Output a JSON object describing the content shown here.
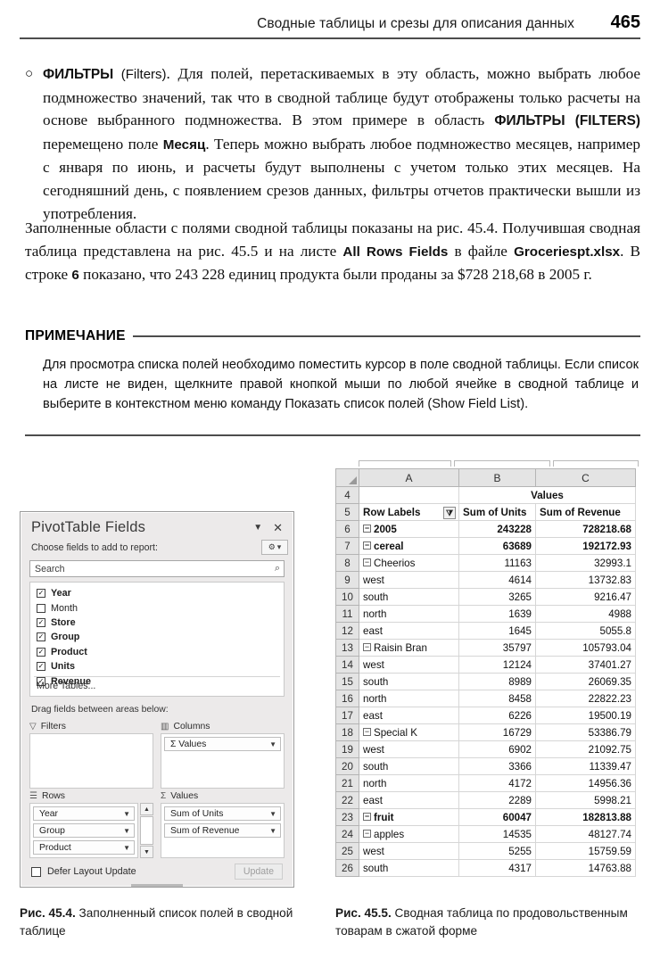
{
  "header": {
    "running_title": "Сводные таблицы и срезы для описания данных",
    "page_number": "465"
  },
  "bullet": {
    "marker": "○",
    "lead_bold": "ФИЛЬТРЫ",
    "lead_paren": "(Filters)",
    "text_1": ". Для полей, перетаскиваемых в эту область, можно выбрать любое подмножество значений, так что в сводной таблице будут отображены только расчеты на основе выбранного подмножества. В этом примере в область ",
    "area_bold": "ФИЛЬТРЫ (FILTERS)",
    "text_2": " перемещено поле ",
    "field_bold": "Месяц",
    "text_3": ". Теперь можно выбрать любое подмножество месяцев, например с января по июнь, и расчеты будут выполнены с учетом только этих месяцев. На сегодняшний день, с появлением срезов данных, фильтры отчетов практически вышли из употребления."
  },
  "paragraph": {
    "t1": "Заполненные области с полями сводной таблицы показаны на рис. 45.4. Получившая сводная таблица представлена на рис. 45.5 и на листе ",
    "sheet_bold": "All Rows Fields",
    "t2": " в файле ",
    "file_bold": "Groceriespt.xlsx",
    "t3": ". В строке ",
    "row_bold": "6",
    "t4": " показано, что 243 228 единиц продукта были проданы за $728 218,68 в 2005 г."
  },
  "note": {
    "title": "ПРИМЕЧАНИЕ",
    "body": "Для просмотра списка полей необходимо поместить курсор в поле сводной таблицы. Если список на листе не виден, щелкните правой кнопкой мыши по любой ячейке в сводной таблице и выберите в контекстном меню команду Показать список полей (Show Field List)."
  },
  "pivot_pane": {
    "title": "PivotTable Fields",
    "collapse_label": "▼",
    "close_label": "✕",
    "subtitle": "Choose fields to add to report:",
    "gear_label": "⚙",
    "gear_caret": "▾",
    "search_placeholder": "Search",
    "search_icon": "⌕",
    "fields": [
      {
        "label": "Year",
        "checked": true
      },
      {
        "label": "Month",
        "checked": false
      },
      {
        "label": "Store",
        "checked": true
      },
      {
        "label": "Group",
        "checked": true
      },
      {
        "label": "Product",
        "checked": true
      },
      {
        "label": "Units",
        "checked": true
      },
      {
        "label": "Revenue",
        "checked": true
      }
    ],
    "more_tables": "More Tables...",
    "drag_text": "Drag fields between areas below:",
    "areas": {
      "filters_label": "Filters",
      "filters_icon": "▽",
      "filters_items": [],
      "columns_label": "Columns",
      "columns_icon": "▥",
      "columns_items": [
        "Σ Values"
      ],
      "rows_label": "Rows",
      "rows_icon": "☰",
      "rows_items": [
        "Year",
        "Group",
        "Product"
      ],
      "values_label": "Values",
      "values_icon": "Σ",
      "values_items": [
        "Sum of Units",
        "Sum of Revenue"
      ]
    },
    "defer_label": "Defer Layout Update",
    "defer_checked": false,
    "update_button": "Update"
  },
  "sheet": {
    "columns": [
      "A",
      "B",
      "C"
    ],
    "merged_values_header": "Values",
    "header_row_number": "4",
    "labels_row_number": "5",
    "row_labels_header": "Row Labels",
    "filter_icon": "⧩",
    "col_b_header": "Sum of Units",
    "col_c_header": "Sum of Revenue",
    "rows": [
      {
        "n": "6",
        "label": "2005",
        "indent": 0,
        "expander": "−",
        "units": "243228",
        "revenue": "728218.68",
        "bold": true
      },
      {
        "n": "7",
        "label": "cereal",
        "indent": 1,
        "expander": "−",
        "units": "63689",
        "revenue": "192172.93",
        "bold": true
      },
      {
        "n": "8",
        "label": "Cheerios",
        "indent": 2,
        "expander": "−",
        "units": "11163",
        "revenue": "32993.1",
        "bold": false
      },
      {
        "n": "9",
        "label": "west",
        "indent": 3,
        "expander": "",
        "units": "4614",
        "revenue": "13732.83",
        "bold": false
      },
      {
        "n": "10",
        "label": "south",
        "indent": 3,
        "expander": "",
        "units": "3265",
        "revenue": "9216.47",
        "bold": false
      },
      {
        "n": "11",
        "label": "north",
        "indent": 3,
        "expander": "",
        "units": "1639",
        "revenue": "4988",
        "bold": false
      },
      {
        "n": "12",
        "label": "east",
        "indent": 3,
        "expander": "",
        "units": "1645",
        "revenue": "5055.8",
        "bold": false
      },
      {
        "n": "13",
        "label": "Raisin Bran",
        "indent": 2,
        "expander": "−",
        "units": "35797",
        "revenue": "105793.04",
        "bold": false
      },
      {
        "n": "14",
        "label": "west",
        "indent": 3,
        "expander": "",
        "units": "12124",
        "revenue": "37401.27",
        "bold": false
      },
      {
        "n": "15",
        "label": "south",
        "indent": 3,
        "expander": "",
        "units": "8989",
        "revenue": "26069.35",
        "bold": false
      },
      {
        "n": "16",
        "label": "north",
        "indent": 3,
        "expander": "",
        "units": "8458",
        "revenue": "22822.23",
        "bold": false
      },
      {
        "n": "17",
        "label": "east",
        "indent": 3,
        "expander": "",
        "units": "6226",
        "revenue": "19500.19",
        "bold": false
      },
      {
        "n": "18",
        "label": "Special K",
        "indent": 2,
        "expander": "−",
        "units": "16729",
        "revenue": "53386.79",
        "bold": false
      },
      {
        "n": "19",
        "label": "west",
        "indent": 3,
        "expander": "",
        "units": "6902",
        "revenue": "21092.75",
        "bold": false
      },
      {
        "n": "20",
        "label": "south",
        "indent": 3,
        "expander": "",
        "units": "3366",
        "revenue": "11339.47",
        "bold": false
      },
      {
        "n": "21",
        "label": "north",
        "indent": 3,
        "expander": "",
        "units": "4172",
        "revenue": "14956.36",
        "bold": false
      },
      {
        "n": "22",
        "label": "east",
        "indent": 3,
        "expander": "",
        "units": "2289",
        "revenue": "5998.21",
        "bold": false
      },
      {
        "n": "23",
        "label": "fruit",
        "indent": 1,
        "expander": "−",
        "units": "60047",
        "revenue": "182813.88",
        "bold": true
      },
      {
        "n": "24",
        "label": "apples",
        "indent": 2,
        "expander": "−",
        "units": "14535",
        "revenue": "48127.74",
        "bold": false
      },
      {
        "n": "25",
        "label": "west",
        "indent": 3,
        "expander": "",
        "units": "5255",
        "revenue": "15759.59",
        "bold": false
      },
      {
        "n": "26",
        "label": "south",
        "indent": 3,
        "expander": "",
        "units": "4317",
        "revenue": "14763.88",
        "bold": false
      }
    ]
  },
  "captions": {
    "fig44_label": "Рис. 45.4.",
    "fig44_text": " Заполненный список полей в сводной таблице",
    "fig45_label": "Рис. 45.5.",
    "fig45_text": " Сводная таблица по продовольственным товарам в сжатой форме"
  }
}
